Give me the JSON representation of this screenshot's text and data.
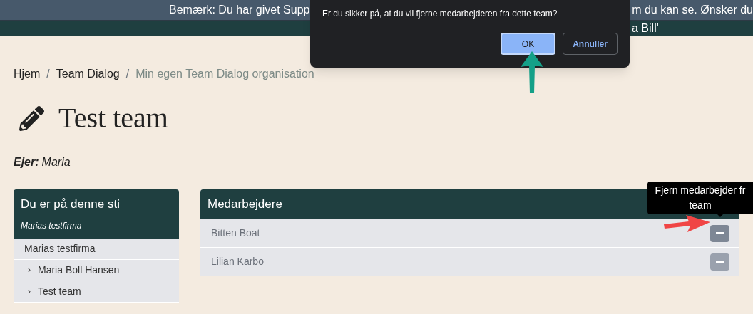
{
  "banner": {
    "line_1": [
      "Bemærk: Du har givet Supp",
      "m du kan se. Ønsker du"
    ],
    "line_2": "a Bill'"
  },
  "dialog": {
    "message": "Er du sikker på, at du vil fjerne medarbejderen fra dette team?",
    "buttons": [
      {
        "label": "OK",
        "selected": true
      },
      {
        "label": "Annuller",
        "selected": false
      }
    ]
  },
  "breadcrumb": [
    {
      "label": "Hjem",
      "current": false
    },
    {
      "separator": "/",
      "label": "Team Dialog",
      "current": false
    },
    {
      "separator": "/",
      "label": "Min egen Team Dialog organisation",
      "current": true
    }
  ],
  "title": "Test team",
  "owner": {
    "label": "Ejer:",
    "value": "Maria"
  },
  "path_card": {
    "title": "Du er på denne sti",
    "subtitle": "Marias testfirma",
    "items": [
      {
        "label": "Marias testfirma",
        "children": [
          {
            "marker": "›",
            "label": "Maria Boll Hansen"
          },
          {
            "marker": "›",
            "label": "Test team"
          }
        ]
      }
    ]
  },
  "members_card": {
    "title": "Medarbejdere",
    "rows": [
      {
        "name": "Bitten Boat",
        "hovered": true
      },
      {
        "name": "Lilian Karbo",
        "hovered": false
      }
    ]
  },
  "tooltip": {
    "lines": [
      "Fjern medarbejder fr",
      "team"
    ]
  }
}
